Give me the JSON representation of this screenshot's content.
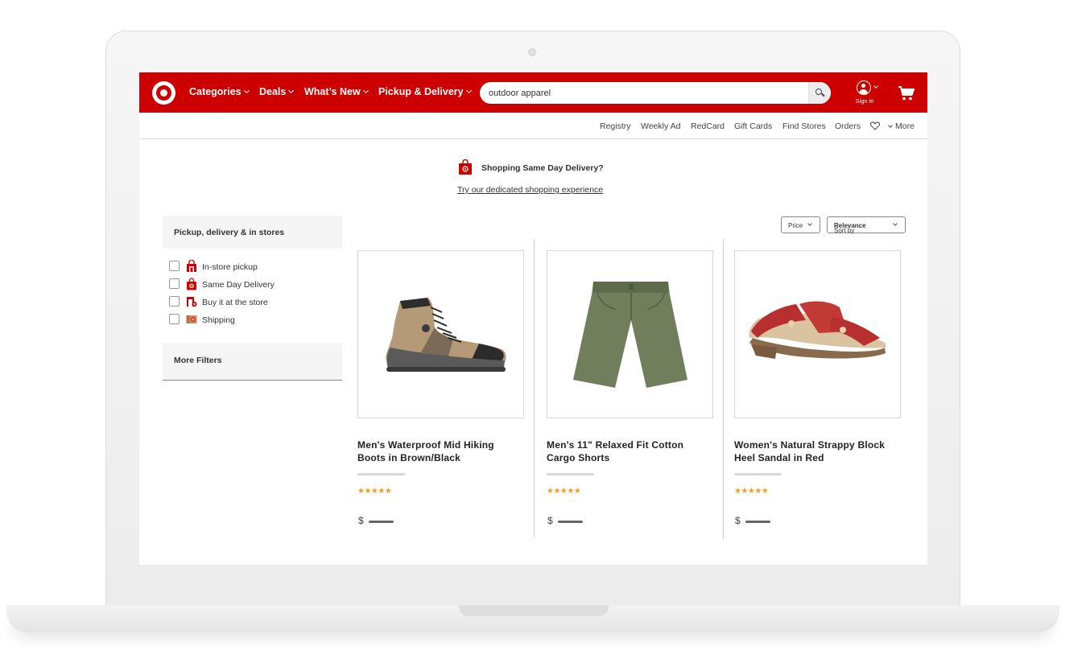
{
  "header": {
    "nav": [
      {
        "label": "Categories"
      },
      {
        "label": "Deals"
      },
      {
        "label": "What’s New"
      },
      {
        "label": "Pickup & Delivery"
      }
    ],
    "search": {
      "value": "outdoor apparel",
      "placeholder": ""
    },
    "account_label": "Sign in"
  },
  "utility_nav": {
    "registry": "Registry",
    "weekly_ad": "Weekly Ad",
    "redcard": "RedCard",
    "gift_cards": "Gift Cards",
    "find_stores": "Find Stores",
    "orders": "Orders",
    "more": "More"
  },
  "banner": {
    "title": "Shopping Same Day Delivery?",
    "link": "Try our dedicated shopping experience"
  },
  "filters": {
    "panel_title": "Pickup, delivery & in stores",
    "options": [
      {
        "label": "In-store pickup",
        "icon": "store-pickup-icon",
        "checked": false
      },
      {
        "label": "Same Day Delivery",
        "icon": "same-day-bag-icon",
        "checked": false
      },
      {
        "label": "Buy it at the store",
        "icon": "buy-in-store-icon",
        "checked": false
      },
      {
        "label": "Shipping",
        "icon": "shipping-box-icon",
        "checked": false
      }
    ],
    "more_filters": "More Filters"
  },
  "sort": {
    "price_label": "Price",
    "sort_prefix": "Sort by",
    "sort_value": "Relevance"
  },
  "products": [
    {
      "name": "Men's Waterproof Mid Hiking Boots in Brown/Black",
      "stars": "★★★★★",
      "currency": "$",
      "image": "hiking-boot"
    },
    {
      "name": "Men's 11\" Relaxed Fit Cotton Cargo Shorts",
      "stars": "★★★★★",
      "currency": "$",
      "image": "cargo-shorts"
    },
    {
      "name": "Women's Natural Strappy Block Heel Sandal in Red",
      "stars": "★★★★★",
      "currency": "$",
      "image": "red-sandal"
    }
  ],
  "colors": {
    "brand_red": "#cc0000",
    "star": "#f0a021"
  }
}
